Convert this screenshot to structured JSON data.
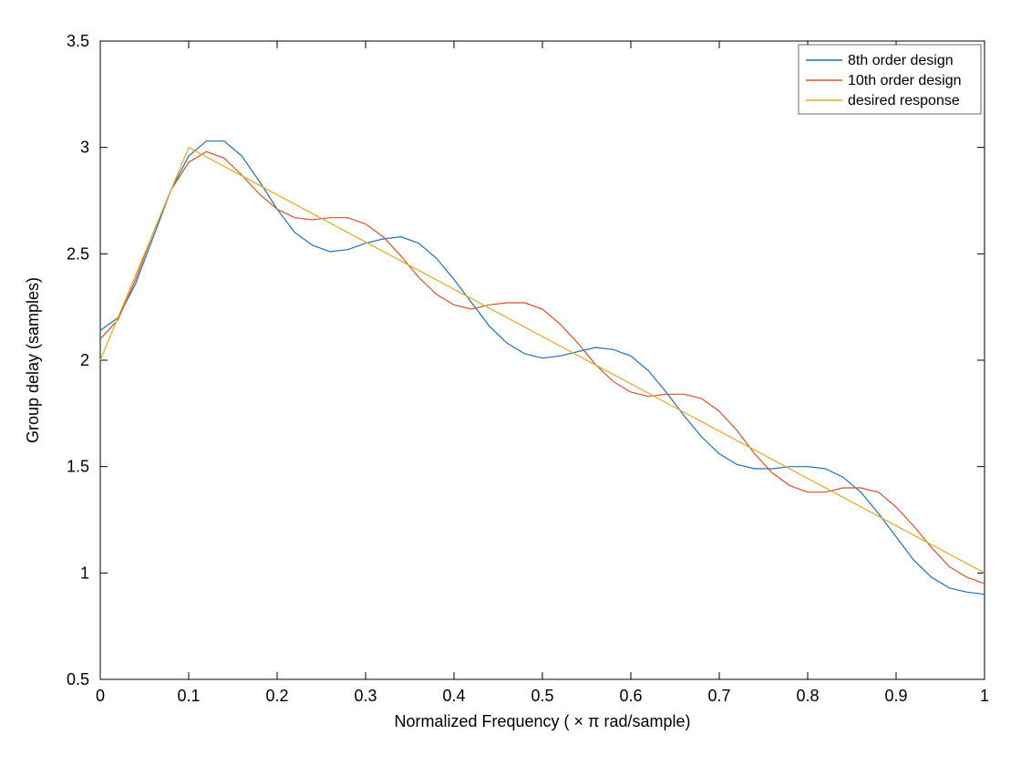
{
  "chart_data": {
    "type": "line",
    "xlabel": "Normalized  Frequency  ( × π rad/sample)",
    "ylabel": "Group delay (samples)",
    "xlim": [
      0,
      1
    ],
    "ylim": [
      0.5,
      3.5
    ],
    "xticks": [
      0,
      0.1,
      0.2,
      0.3,
      0.4,
      0.5,
      0.6,
      0.7,
      0.8,
      0.9,
      1
    ],
    "yticks": [
      0.5,
      1,
      1.5,
      2,
      2.5,
      3,
      3.5
    ],
    "legend": {
      "position": "northeast",
      "entries": [
        "8th order design",
        "10th order design",
        "desired response"
      ]
    },
    "colors": {
      "s1": "#2070b4",
      "s2": "#d1532b",
      "s3": "#e2a820"
    },
    "series": [
      {
        "name": "8th order design",
        "x": [
          0.0,
          0.02,
          0.04,
          0.06,
          0.08,
          0.1,
          0.12,
          0.14,
          0.16,
          0.18,
          0.2,
          0.22,
          0.24,
          0.26,
          0.28,
          0.3,
          0.32,
          0.34,
          0.36,
          0.38,
          0.4,
          0.42,
          0.44,
          0.46,
          0.48,
          0.5,
          0.52,
          0.54,
          0.56,
          0.58,
          0.6,
          0.62,
          0.64,
          0.66,
          0.68,
          0.7,
          0.72,
          0.74,
          0.76,
          0.78,
          0.8,
          0.82,
          0.84,
          0.86,
          0.88,
          0.9,
          0.92,
          0.94,
          0.96,
          0.98,
          1.0
        ],
        "y": [
          2.14,
          2.2,
          2.36,
          2.58,
          2.8,
          2.96,
          3.03,
          3.03,
          2.96,
          2.84,
          2.71,
          2.6,
          2.54,
          2.51,
          2.52,
          2.55,
          2.57,
          2.58,
          2.55,
          2.48,
          2.38,
          2.27,
          2.16,
          2.08,
          2.03,
          2.01,
          2.02,
          2.04,
          2.06,
          2.05,
          2.02,
          1.95,
          1.85,
          1.74,
          1.64,
          1.56,
          1.51,
          1.49,
          1.49,
          1.5,
          1.5,
          1.49,
          1.45,
          1.38,
          1.28,
          1.17,
          1.06,
          0.98,
          0.93,
          0.91,
          0.9
        ]
      },
      {
        "name": "10th order design",
        "x": [
          0.0,
          0.02,
          0.04,
          0.06,
          0.08,
          0.1,
          0.12,
          0.14,
          0.16,
          0.18,
          0.2,
          0.22,
          0.24,
          0.26,
          0.28,
          0.3,
          0.32,
          0.34,
          0.36,
          0.38,
          0.4,
          0.42,
          0.44,
          0.46,
          0.48,
          0.5,
          0.52,
          0.54,
          0.56,
          0.58,
          0.6,
          0.62,
          0.64,
          0.66,
          0.68,
          0.7,
          0.72,
          0.74,
          0.76,
          0.78,
          0.8,
          0.82,
          0.84,
          0.86,
          0.88,
          0.9,
          0.92,
          0.94,
          0.96,
          0.98,
          1.0
        ],
        "y": [
          2.1,
          2.19,
          2.38,
          2.6,
          2.8,
          2.93,
          2.98,
          2.95,
          2.87,
          2.78,
          2.71,
          2.67,
          2.66,
          2.67,
          2.67,
          2.64,
          2.58,
          2.49,
          2.39,
          2.31,
          2.26,
          2.24,
          2.26,
          2.27,
          2.27,
          2.24,
          2.17,
          2.08,
          1.98,
          1.9,
          1.85,
          1.83,
          1.84,
          1.84,
          1.82,
          1.76,
          1.67,
          1.56,
          1.47,
          1.41,
          1.38,
          1.38,
          1.4,
          1.4,
          1.38,
          1.31,
          1.22,
          1.12,
          1.03,
          0.98,
          0.95
        ]
      },
      {
        "name": "desired response",
        "x": [
          0.0,
          0.1,
          1.0
        ],
        "y": [
          2.0,
          3.0,
          1.0
        ]
      }
    ]
  },
  "xtick_labels": [
    "0",
    "0.1",
    "0.2",
    "0.3",
    "0.4",
    "0.5",
    "0.6",
    "0.7",
    "0.8",
    "0.9",
    "1"
  ],
  "ytick_labels": [
    "0.5",
    "1",
    "1.5",
    "2",
    "2.5",
    "3",
    "3.5"
  ]
}
